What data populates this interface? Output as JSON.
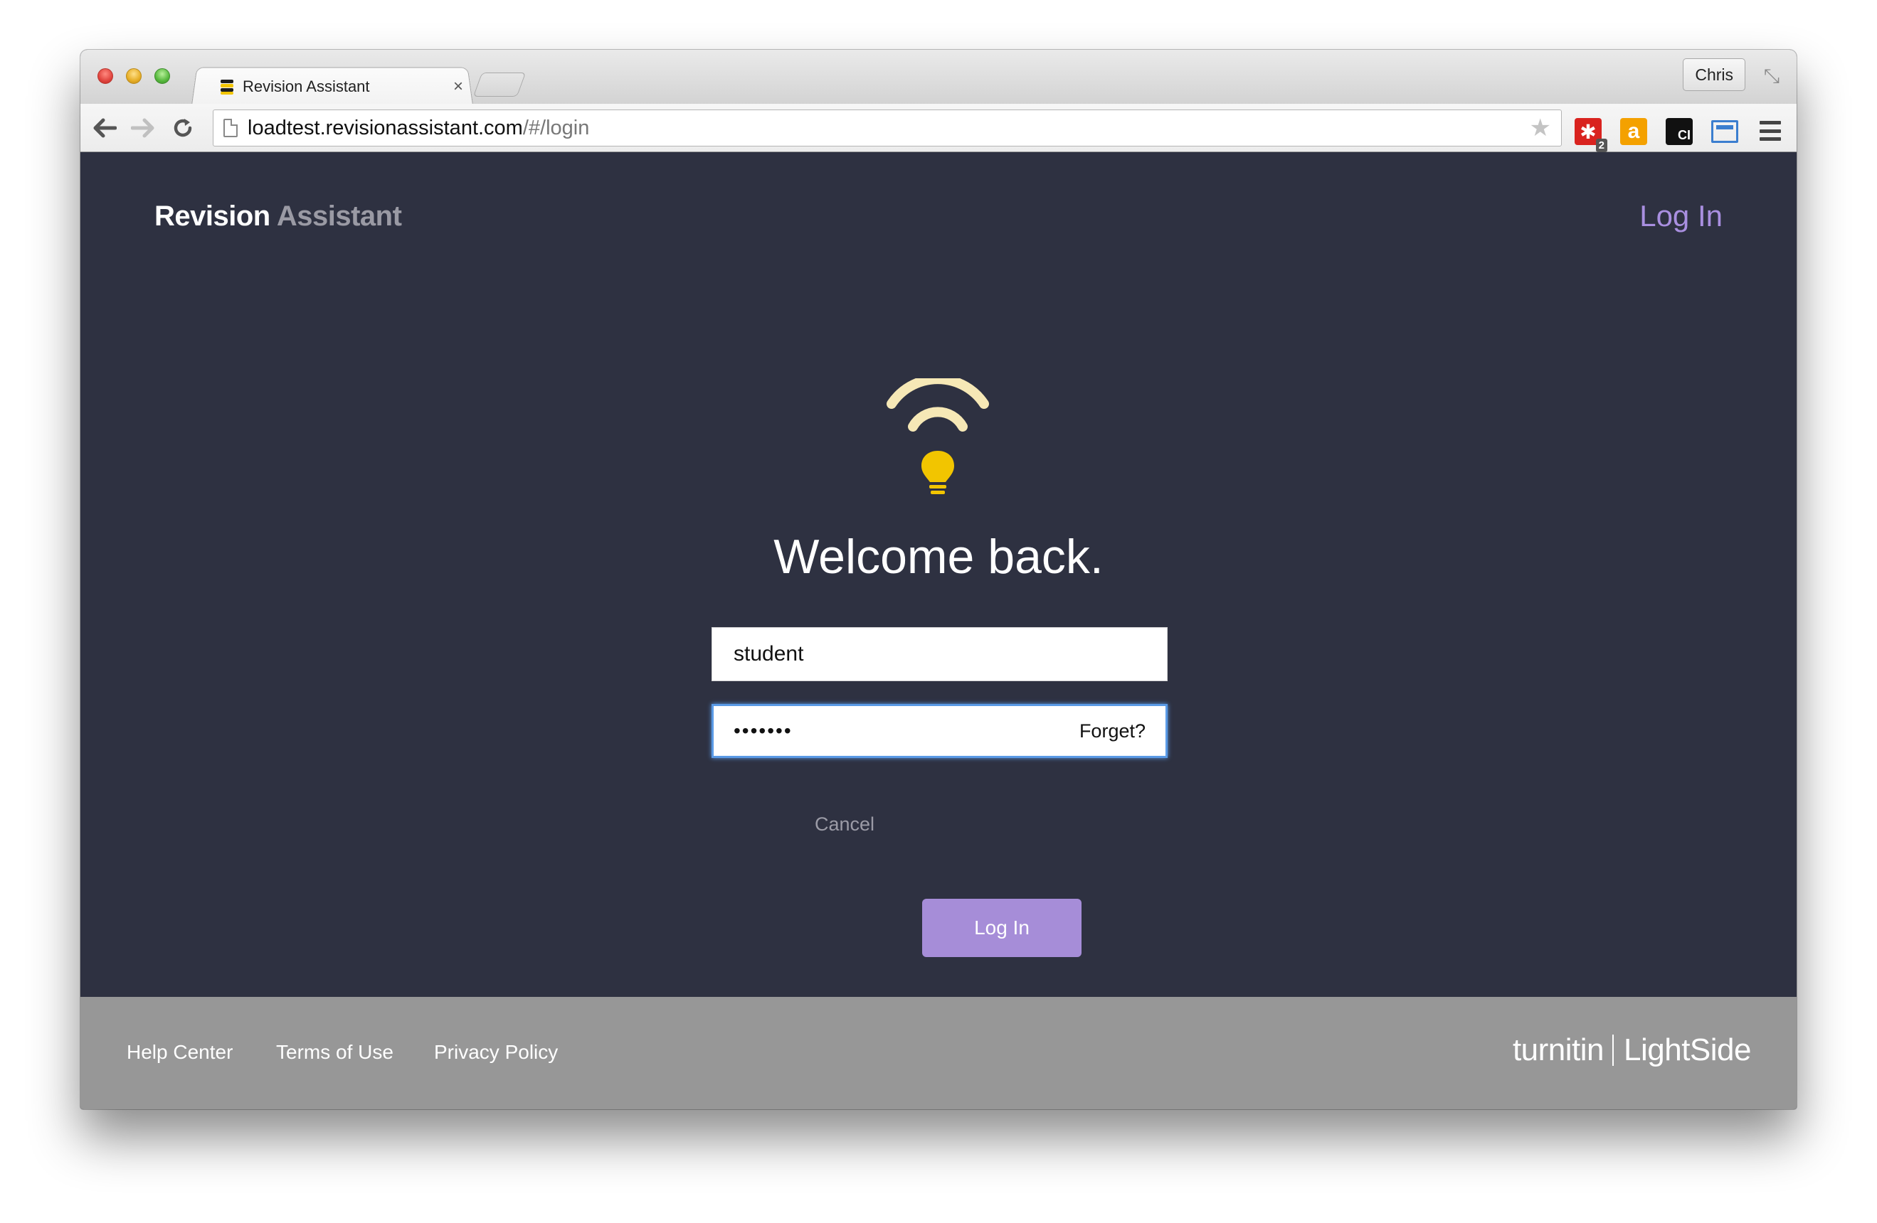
{
  "browser": {
    "tab_title": "Revision Assistant",
    "tab_close": "×",
    "profile_name": "Chris",
    "url_host": "loadtest.revisionassistant.com",
    "url_path": "/#/login",
    "extensions": {
      "lastpass_badge": "2",
      "amazon_label": "a",
      "ci_label": "CI"
    }
  },
  "header": {
    "brand_bold": "Revision",
    "brand_light": "Assistant",
    "login_link": "Log In"
  },
  "main": {
    "heading": "Welcome back.",
    "username_value": "student",
    "password_mask": "•••••••",
    "forget_link": "Forget?",
    "cancel_label": "Cancel",
    "login_button": "Log In"
  },
  "footer": {
    "links": [
      "Help Center",
      "Terms of Use",
      "Privacy Policy"
    ],
    "logo_left": "turnitin",
    "logo_right": "LightSide"
  },
  "colors": {
    "page_bg": "#2e3141",
    "accent_purple": "#a68dd8",
    "bulb_yellow": "#f2c500",
    "signal_cream": "#f6e8b6",
    "footer_bg": "#979797"
  }
}
